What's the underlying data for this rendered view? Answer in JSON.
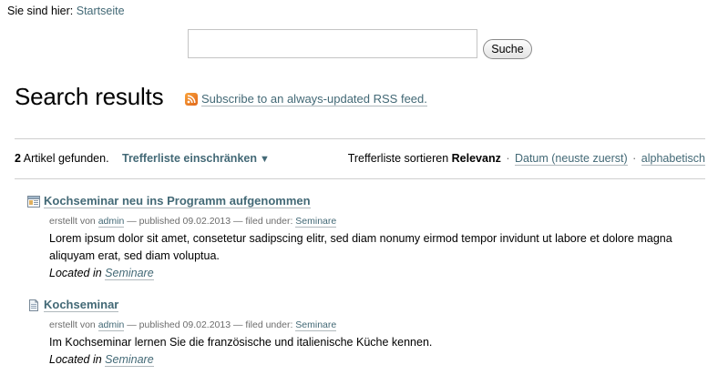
{
  "breadcrumbs": {
    "prefix": "Sie sind hier:",
    "home": "Startseite"
  },
  "search": {
    "value": "",
    "placeholder": "",
    "button": "Suche"
  },
  "page_title": "Search results",
  "rss": {
    "icon": "rss-feed-icon",
    "link": "Subscribe to an always-updated RSS feed."
  },
  "summary": {
    "count": "2",
    "count_suffix": "Artikel gefunden.",
    "refine": "Trefferliste einschränken",
    "refine_icon": "triangle-down-icon"
  },
  "sorting": {
    "label": "Trefferliste sortieren",
    "current": "Relevanz",
    "options": [
      "Datum (neuste zuerst)",
      "alphabetisch"
    ],
    "separator": "·"
  },
  "results": [
    {
      "icon": "news-item-icon",
      "title": "Kochseminar neu ins Programm aufgenommen",
      "byline_prefix": "erstellt von",
      "author": "admin",
      "published": "— published 09.02.2013 — filed under:",
      "category": "Seminare",
      "description": "Lorem ipsum dolor sit amet, consetetur sadipscing elitr, sed diam nonumy eirmod tempor invidunt ut labore et dolore magna aliquyam erat, sed diam voluptua.",
      "located_prefix": "Located in",
      "located_link": "Seminare"
    },
    {
      "icon": "page-document-icon",
      "title": "Kochseminar",
      "byline_prefix": "erstellt von",
      "author": "admin",
      "published": "— published 09.02.2013 — filed under:",
      "category": "Seminare",
      "description": "Im Kochseminar lernen Sie die französische und italienische Küche kennen.",
      "located_prefix": "Located in",
      "located_link": "Seminare"
    }
  ],
  "colors": {
    "link": "#436976",
    "rule": "#cfcfcf",
    "byline": "#6c6c6c",
    "rss_orange": "#f28a2e"
  }
}
